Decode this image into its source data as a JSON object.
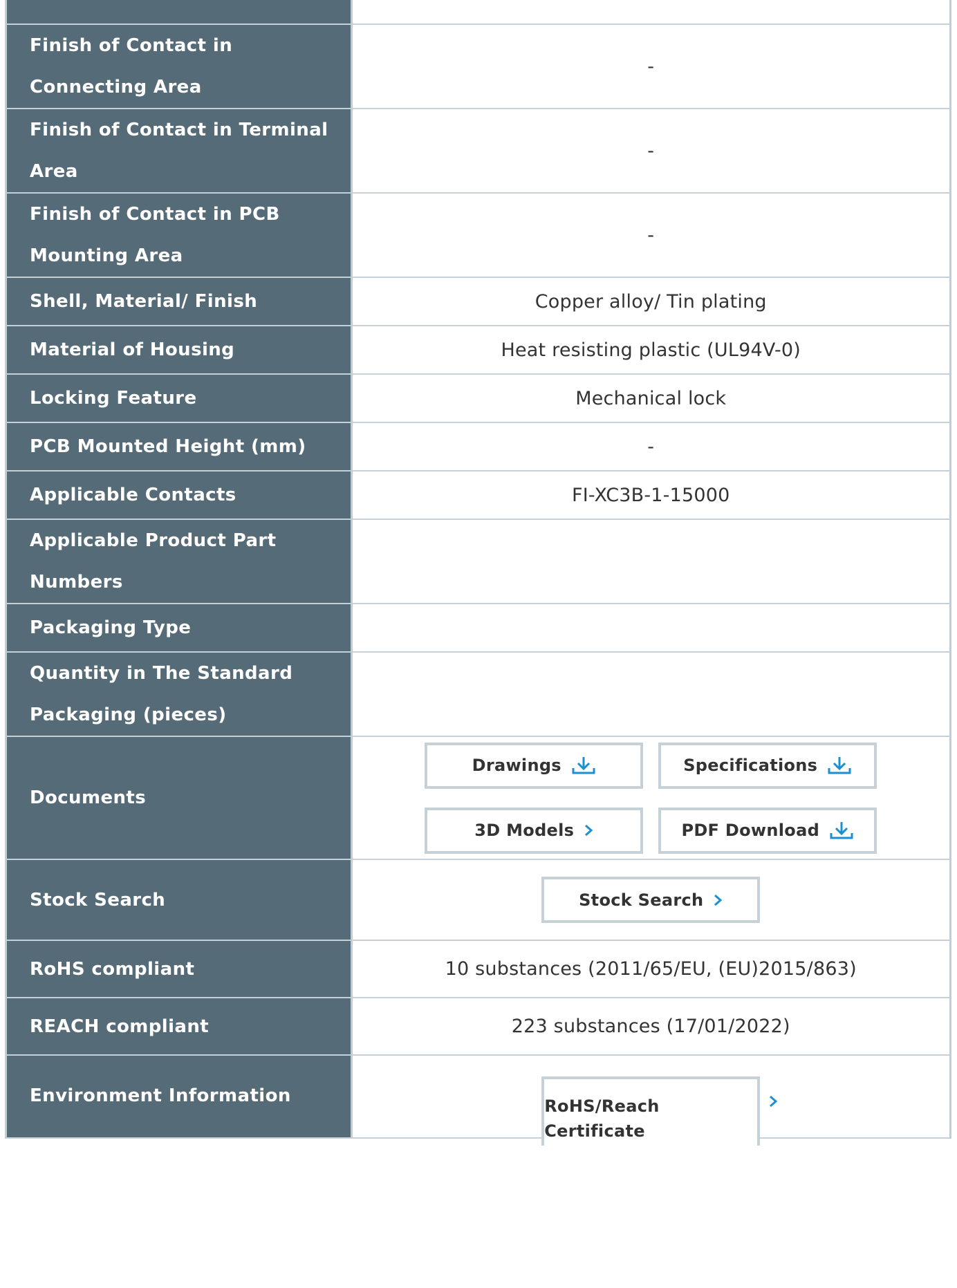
{
  "rows": [
    {
      "label": "",
      "value": ""
    },
    {
      "label": "Finish of Contact in Connecting Area",
      "value": "-"
    },
    {
      "label": "Finish of Contact in Terminal Area",
      "value": "-"
    },
    {
      "label": "Finish of Contact in PCB Mounting Area",
      "value": "-"
    },
    {
      "label": "Shell, Material/ Finish",
      "value": "Copper alloy/ Tin plating"
    },
    {
      "label": "Material of Housing",
      "value": "Heat resisting plastic (UL94V-0)"
    },
    {
      "label": "Locking Feature",
      "value": "Mechanical lock"
    },
    {
      "label": "PCB Mounted Height (mm)",
      "value": "-"
    },
    {
      "label": "Applicable Contacts",
      "value": "FI-XC3B-1-15000"
    },
    {
      "label": "Applicable Product Part Numbers",
      "value": ""
    },
    {
      "label": "Packaging Type",
      "value": ""
    },
    {
      "label": "Quantity in The Standard Packaging (pieces)",
      "value": ""
    },
    {
      "label": "Documents"
    },
    {
      "label": "Stock Search"
    },
    {
      "label": "RoHS compliant",
      "value": "10 substances (2011/65/EU, (EU)2015/863)"
    },
    {
      "label": "REACH compliant",
      "value": "223 substances (17/01/2022)"
    },
    {
      "label": "Environment Information"
    }
  ],
  "documents": {
    "drawings": "Drawings",
    "specifications": "Specifications",
    "models_3d": "3D Models",
    "pdf_download": "PDF Download"
  },
  "stock": {
    "button": "Stock Search"
  },
  "environment": {
    "button_line1": "RoHS/Reach",
    "button_line2": "Certificate"
  },
  "icons": {
    "download": "download-icon",
    "chevron": "chevron-right-icon"
  },
  "colors": {
    "label_bg": "#566b78",
    "border": "#c6d0d7",
    "accent": "#1a8fd1"
  }
}
